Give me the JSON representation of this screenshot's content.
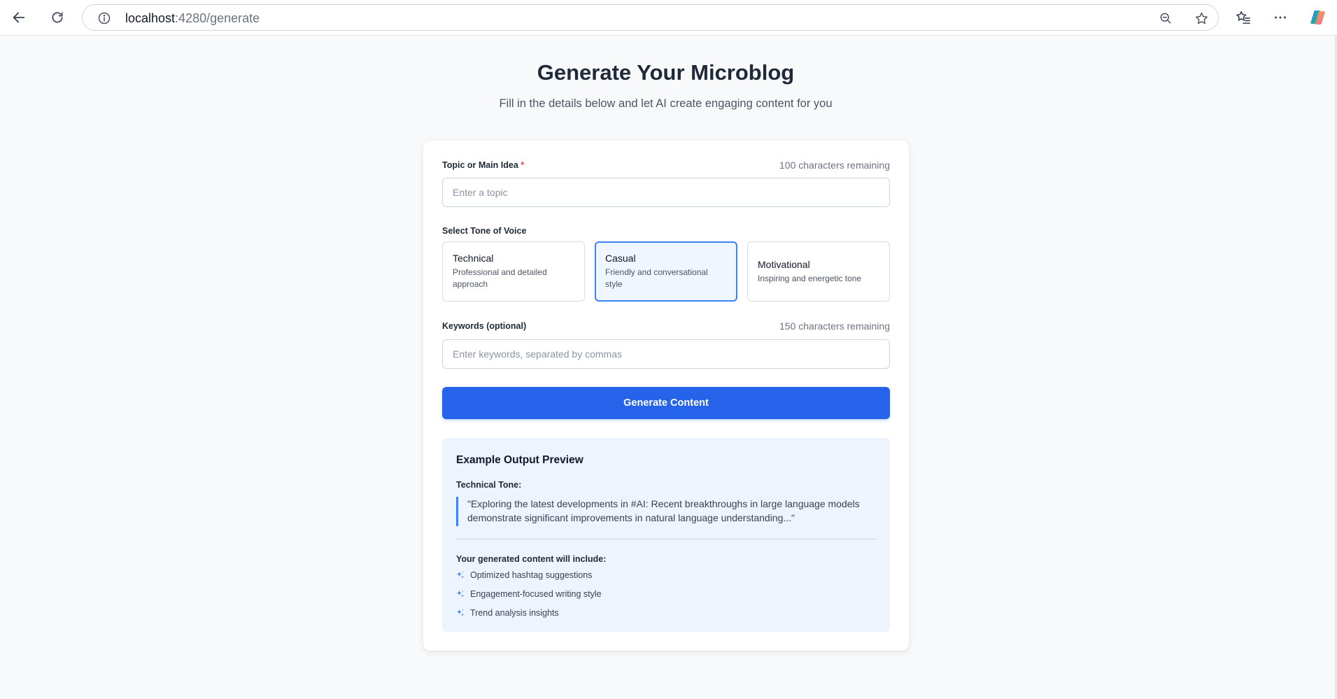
{
  "browser": {
    "url_host": "localhost",
    "url_path": ":4280/generate",
    "icons": [
      "back-arrow-icon",
      "refresh-icon",
      "info-icon",
      "zoom-out-icon",
      "star-icon",
      "favorites-icon",
      "more-icon",
      "copilot-icon"
    ]
  },
  "header": {
    "title": "Generate Your Microblog",
    "subtitle": "Fill in the details below and let AI create engaging content for you"
  },
  "form": {
    "topic": {
      "label": "Topic or Main Idea",
      "required_marker": "*",
      "char_count": "100 characters remaining",
      "placeholder": "Enter a topic",
      "value": ""
    },
    "tone": {
      "label": "Select Tone of Voice",
      "options": [
        {
          "name": "Technical",
          "description": "Professional and detailed approach",
          "selected": false
        },
        {
          "name": "Casual",
          "description": "Friendly and conversational style",
          "selected": true
        },
        {
          "name": "Motivational",
          "description": "Inspiring and energetic tone",
          "selected": false
        }
      ]
    },
    "keywords": {
      "label": "Keywords (optional)",
      "char_count": "150 characters remaining",
      "placeholder": "Enter keywords, separated by commas",
      "value": ""
    },
    "submit_label": "Generate Content"
  },
  "preview": {
    "title": "Example Output Preview",
    "tone_label": "Technical Tone:",
    "quote": "\"Exploring the latest developments in #AI: Recent breakthroughs in large language models demonstrate significant improvements in natural language understanding...\"",
    "includes_title": "Your generated content will include:",
    "features": [
      "Optimized hashtag suggestions",
      "Engagement-focused writing style",
      "Trend analysis insights"
    ]
  },
  "colors": {
    "primary": "#2563eb",
    "selected_border": "#3b82f6",
    "selected_bg": "#eff6ff",
    "preview_bg": "#eef4fe",
    "required": "#ef4444"
  }
}
